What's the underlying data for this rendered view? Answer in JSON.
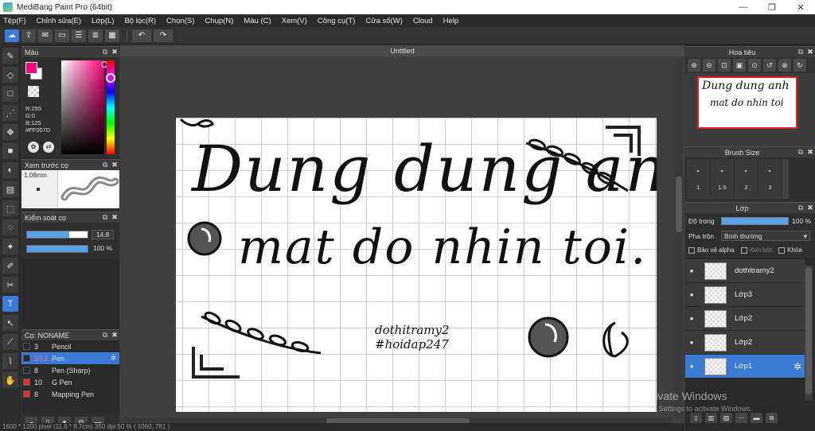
{
  "window": {
    "title": "MediBang Paint Pro (64bit)",
    "minimize": "—",
    "maximize": "❐",
    "close": "✕"
  },
  "menu": [
    "Tệp(F)",
    "Chỉnh sửa(E)",
    "Lớp(L)",
    "Bộ lọc(R)",
    "Chọn(S)",
    "Chụp(N)",
    "Màu (C)",
    "Xem(V)",
    "Công cụ(T)",
    "Cửa số(W)",
    "Cloud",
    "Help"
  ],
  "toolbar": {
    "undo": "↶",
    "redo": "↷"
  },
  "color_panel": {
    "title": "Màu",
    "r": "R:255",
    "g": "G:0",
    "b": "B:125",
    "hex": "#FF007D",
    "fg_color": "#ff007d"
  },
  "brush_preview": {
    "title": "Xem trước cọ",
    "size": "1.08mm"
  },
  "brush_control": {
    "title": "Kiểm soát cọ",
    "size_value": "14.8",
    "size_fraction": 0.7,
    "opacity_value": "100 %",
    "opacity_fraction": 1.0
  },
  "brush_list": {
    "title": "Cọ: NONAME",
    "items": [
      {
        "num": "3",
        "name": "Pencil",
        "color": "#2a2a2a"
      },
      {
        "num": "10.2",
        "name": "Pen",
        "color": "#2a2a2a",
        "selected": true
      },
      {
        "num": "8",
        "name": "Pen (Sharp)",
        "color": "#2a2a2a"
      },
      {
        "num": "10",
        "name": "G Pen",
        "color": "#e03030"
      },
      {
        "num": "8",
        "name": "Mapping Pen",
        "color": "#e03030"
      }
    ]
  },
  "canvas": {
    "tab": "Untitled",
    "line1": "Dung dung anh",
    "line2": "mat do nhin toi.",
    "sign1": "dothitramy2",
    "sign2": "#hoidap247"
  },
  "status": "1600 * 1200 pixel   (11.6 * 8.7cm)   350 dpi   50 %   ( 1060, 781 )",
  "navigator": {
    "title": "Hoa tiêu",
    "thumb_line1": "Dung dung anh",
    "thumb_line2": "mat do nhin toi"
  },
  "brush_size": {
    "title": "Brush Size",
    "sizes": [
      "1",
      "1.5",
      "2",
      "3"
    ]
  },
  "layer_panel": {
    "title": "Lớp",
    "opacity_label": "Độ trong",
    "opacity_value": "100 %",
    "blend_label": "Pha trộn",
    "blend_value": "Bình thường",
    "protect_alpha": "Bảo vệ alpha",
    "clip": "Xén bớt",
    "lock": "Khóa",
    "layers": [
      {
        "name": "dothitramy2",
        "selected": false
      },
      {
        "name": "Lớp3",
        "selected": false
      },
      {
        "name": "Lớp2",
        "selected": false
      },
      {
        "name": "Lớp2",
        "selected": false
      },
      {
        "name": "Lớp1",
        "selected": true
      }
    ]
  },
  "watermark": {
    "line1": "Activate Windows",
    "line2": "Go to Settings to activate Windows."
  }
}
